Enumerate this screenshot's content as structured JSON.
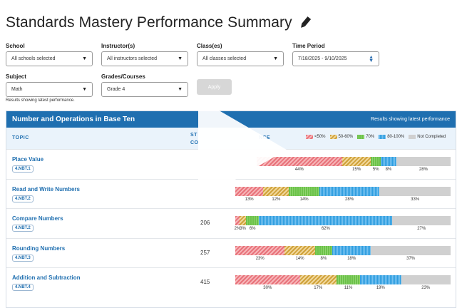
{
  "page": {
    "title": "Standards Mastery Performance Summary"
  },
  "filters": {
    "school": {
      "label": "School",
      "value": "All schools selected"
    },
    "instructor": {
      "label": "Instructor(s)",
      "value": "All instructors selected"
    },
    "classes": {
      "label": "Class(es)",
      "value": "All classes selected"
    },
    "time": {
      "label": "Time Period",
      "value": "7/18/2025 - 9/10/2025"
    },
    "subject": {
      "label": "Subject",
      "value": "Math"
    },
    "grade": {
      "label": "Grades/Courses",
      "value": "Grade 4"
    },
    "apply_label": "Apply",
    "results_note": "Results showing latest performance."
  },
  "panel": {
    "title": "Number and Operations in Base Ten",
    "note": "Results showing latest performance",
    "headers": {
      "topic": "TOPIC",
      "students_1": "ST",
      "students_2": "CO",
      "performance": "NCE"
    },
    "legend": [
      {
        "label": "<50%",
        "class": "s-red"
      },
      {
        "label": "50-60%",
        "class": "s-gold"
      },
      {
        "label": "70%",
        "class": "s-green"
      },
      {
        "label": "80-100%",
        "class": "s-blue"
      },
      {
        "label": "Not Completed",
        "class": "s-gray"
      }
    ]
  },
  "rows": [
    {
      "topic": "Place Value",
      "standard": "4.NBT.1",
      "students": "",
      "segments": [
        11,
        44,
        15,
        5,
        8,
        28
      ],
      "labels": [
        "",
        "44%",
        "15%",
        "5%",
        "8%",
        "28%"
      ]
    },
    {
      "topic": "Read and Write Numbers",
      "standard": "4.NBT.2",
      "students": "",
      "segments": [
        0,
        13,
        12,
        14,
        28,
        33
      ],
      "labels": [
        "",
        "13%",
        "12%",
        "14%",
        "28%",
        "33%"
      ]
    },
    {
      "topic": "Compare Numbers",
      "standard": "4.NBT.2",
      "students": "206",
      "segments": [
        0,
        2,
        3,
        6,
        62,
        27
      ],
      "labels": [
        "",
        "2%",
        "3%",
        "6%",
        "62%",
        "27%"
      ]
    },
    {
      "topic": "Rounding Numbers",
      "standard": "4.NBT.3",
      "students": "257",
      "segments": [
        0,
        23,
        14,
        8,
        18,
        37
      ],
      "labels": [
        "",
        "23%",
        "14%",
        "8%",
        "18%",
        "37%"
      ]
    },
    {
      "topic": "Addition and Subtraction",
      "standard": "4.NBT.4",
      "students": "415",
      "segments": [
        0,
        30,
        17,
        11,
        19,
        23
      ],
      "labels": [
        "",
        "30%",
        "17%",
        "11%",
        "19%",
        "23%"
      ]
    }
  ]
}
